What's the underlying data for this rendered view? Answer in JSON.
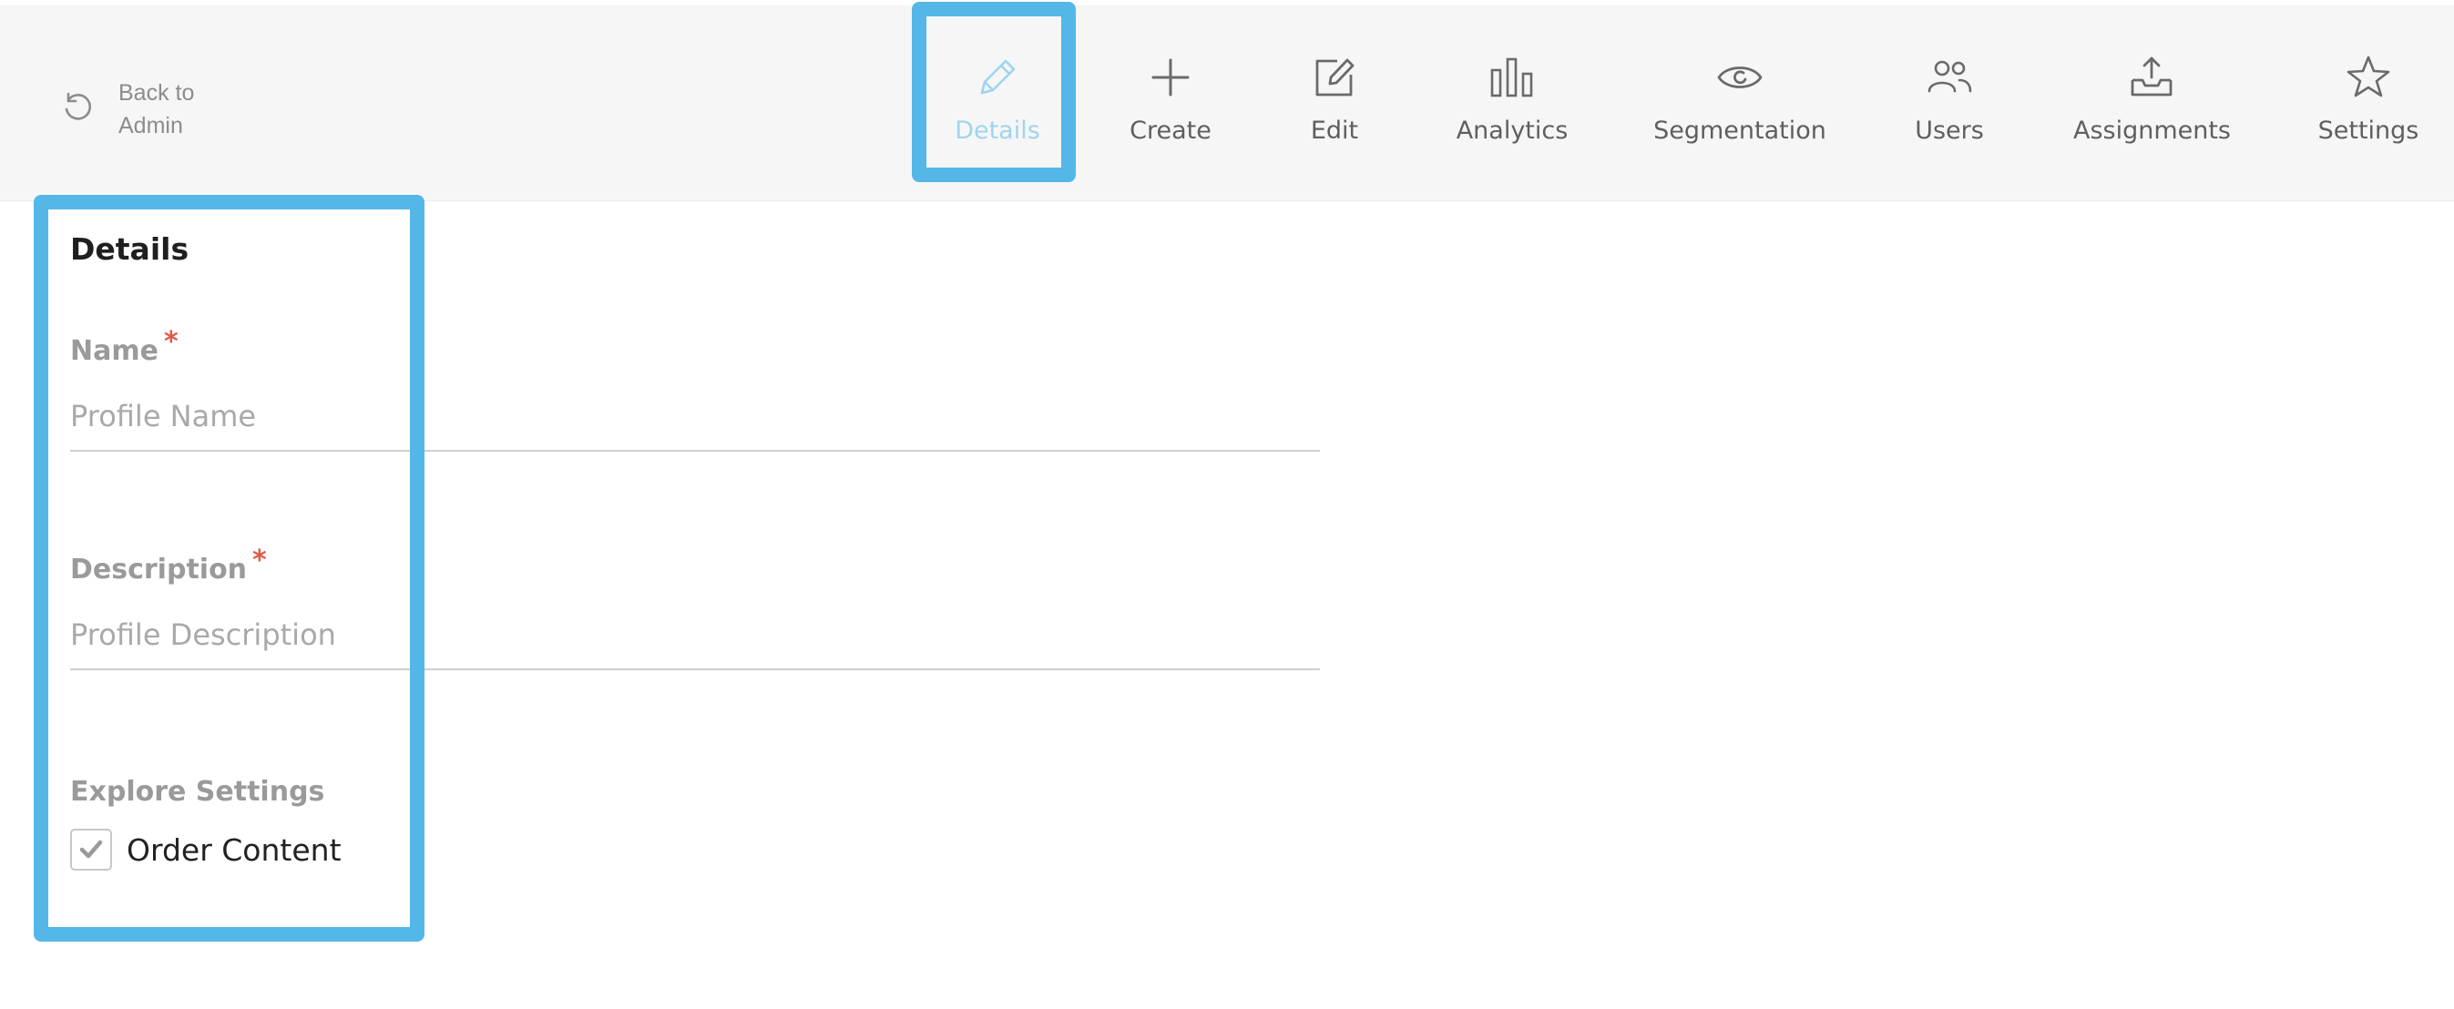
{
  "back": {
    "label_line1": "Back to",
    "label_line2": "Admin",
    "icon": "refresh-back-icon"
  },
  "tabs": [
    {
      "key": "details",
      "label": "Details",
      "icon": "pencil-icon",
      "active": true
    },
    {
      "key": "create",
      "label": "Create",
      "icon": "plus-icon"
    },
    {
      "key": "edit",
      "label": "Edit",
      "icon": "edit-square-icon"
    },
    {
      "key": "analytics",
      "label": "Analytics",
      "icon": "bar-chart-icon"
    },
    {
      "key": "segmentation",
      "label": "Segmentation",
      "icon": "eye-icon"
    },
    {
      "key": "users",
      "label": "Users",
      "icon": "users-icon"
    },
    {
      "key": "assignments",
      "label": "Assignments",
      "icon": "inbox-upload-icon"
    },
    {
      "key": "settings",
      "label": "Settings",
      "icon": "star-icon"
    }
  ],
  "form": {
    "title": "Details",
    "name": {
      "label": "Name",
      "required_mark": "*",
      "placeholder": "Profile Name",
      "value": ""
    },
    "description": {
      "label": "Description",
      "required_mark": "*",
      "placeholder": "Profile Description",
      "value": ""
    },
    "explore_settings": {
      "label": "Explore Settings",
      "order_content": {
        "label": "Order Content",
        "checked": true
      }
    }
  },
  "colors": {
    "highlight": "#54b7e8",
    "active_tab_text": "#9fd4f1",
    "required": "#e05a48",
    "toolbar_bg": "#f6f6f6"
  }
}
